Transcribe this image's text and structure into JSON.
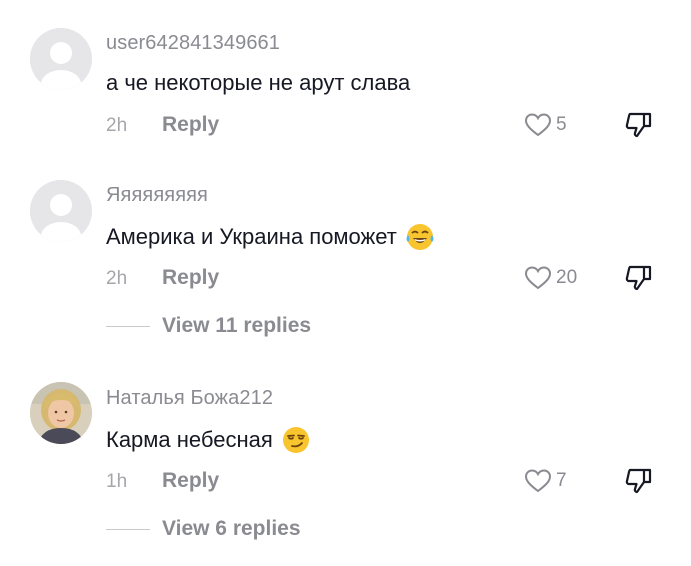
{
  "comments": [
    {
      "username": "user642841349661",
      "text": "а че некоторые не арут слава",
      "time": "2h",
      "reply_label": "Reply",
      "likes": "5",
      "avatar": "default-avatar",
      "emoji": null
    },
    {
      "username": "Яяяяяяяяя",
      "text": "Америка и Украина поможет",
      "time": "2h",
      "reply_label": "Reply",
      "likes": "20",
      "avatar": "default-avatar",
      "emoji": "tears-of-joy-emoji",
      "view_replies": "View 11 replies"
    },
    {
      "username": "Наталья Божа212",
      "text": "Карма небесная",
      "time": "1h",
      "reply_label": "Reply",
      "likes": "7",
      "avatar": "photo-avatar",
      "emoji": "smirking-face-emoji",
      "view_replies": "View 6 replies"
    }
  ],
  "colors": {
    "primary_text": "#161823",
    "secondary_text": "#8a8b91",
    "avatar_bg": "#e6e6e8"
  }
}
